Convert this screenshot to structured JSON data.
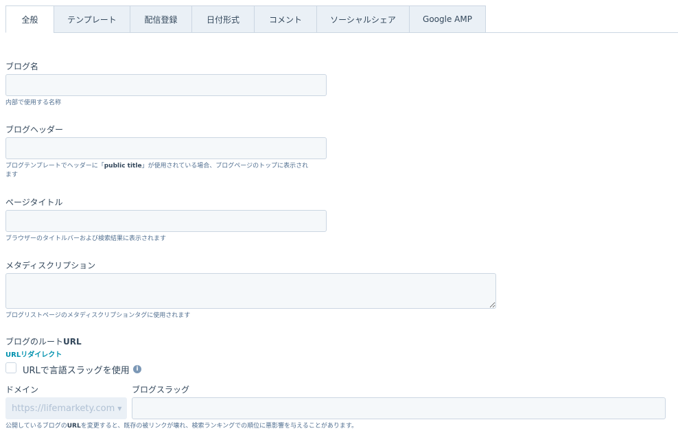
{
  "tabs": [
    {
      "label": "全般"
    },
    {
      "label": "テンプレート"
    },
    {
      "label": "配信登録"
    },
    {
      "label": "日付形式"
    },
    {
      "label": "コメント"
    },
    {
      "label": "ソーシャルシェア"
    },
    {
      "label": "Google AMP"
    }
  ],
  "blog_name": {
    "label": "ブログ名",
    "value": "",
    "help": "内部で使用する名称"
  },
  "blog_header": {
    "label": "ブログヘッダー",
    "value": "",
    "help_pre": "ブログテンプレートでヘッダーに「",
    "help_bold": "public title",
    "help_post": "」が使用されている場合、ブログページのトップに表示され",
    "help_line2": "ます"
  },
  "page_title": {
    "label": "ページタイトル",
    "value": "",
    "help": "ブラウザーのタイトルバーおよび検索結果に表示されます"
  },
  "meta_description": {
    "label": "メタディスクリプション",
    "value": "",
    "help": "ブログリストページのメタディスクリプションタグに使用されます"
  },
  "root_url": {
    "label_pre": "ブログのルート",
    "label_bold": "URL",
    "redirect_link": "URLリダイレクト",
    "lang_slug_checkbox": "URLで言語スラッグを使用",
    "domain_label": "ドメイン",
    "domain_value": "https://lifemarkety.com",
    "slug_label": "ブログスラッグ",
    "slug_value": "",
    "warning_pre": "公開しているブログの",
    "warning_bold": "URL",
    "warning_post": "を変更すると、既存の被リンクが壊れ、検索ランキングでの順位に悪影響を与えることがあります。"
  },
  "icons": {
    "info": "info-icon",
    "caret": "caret-down-icon"
  }
}
